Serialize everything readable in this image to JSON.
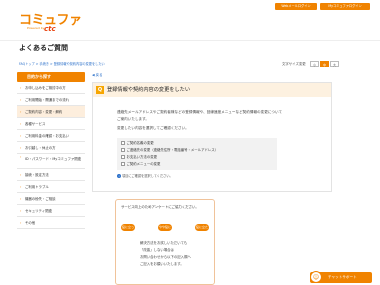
{
  "header": {
    "logo": "コミュファ",
    "logo_sub": "Powered by",
    "logo_brand": "ctc",
    "top_links": [
      "Webメールログイン",
      "Myコミュファログイン"
    ]
  },
  "page_title": "よくあるご質問",
  "breadcrumb": "FAQトップ > 手続き > 登録情報や契約内容の変更をしたい",
  "font_size": {
    "label": "文字サイズ変更",
    "small": "小",
    "medium": "中",
    "large": "大"
  },
  "sidebar": {
    "head": "目的から探す",
    "items": [
      {
        "label": "お申し込みをご検討中の方"
      },
      {
        "label": "ご利用開始・開通までの流れ"
      },
      {
        "label": "ご契約内容・変更・解約"
      },
      {
        "label": "各種サービス"
      },
      {
        "label": "ご利用料金の確認・お支払い"
      },
      {
        "label": "お引越し・休止の方"
      },
      {
        "label": "ID・パスワード・Myコミュファ関連"
      },
      {
        "label": "接続・設定方法"
      },
      {
        "label": "ご利用トラブル"
      },
      {
        "label": "機器の紛失・ご相談"
      },
      {
        "label": "セキュリティ関連"
      },
      {
        "label": "その他"
      }
    ]
  },
  "main": {
    "back": "◀ 戻る",
    "q_badge": "Q",
    "q_title": "登録情報や契約内容の変更をしたい",
    "body": [
      "連絡先メールアドレスやご契約者様などの登録情報や、回線速度メニューなど契約情報の変更について",
      "ご案内いたします。",
      "変更したい内容を選択してご確認ください。"
    ],
    "choices": [
      "ご契約名義の変更",
      "ご連絡先の変更（連絡先住所・電話番号・メールアドレス）",
      "お支払い方法の変更",
      "ご契約メニューの変更"
    ],
    "note": "項目にご確認を選択してください。"
  },
  "survey": {
    "title": "サービス向上のためアンケートにご協力ください。",
    "ratings": [
      "役に立った",
      "やや役に立った",
      "役に立たなかった"
    ],
    "text": [
      "解決方法をお試しいただいても",
      "「改善」しない場合は",
      "お問い合わせから以下の記入欄へ",
      "ご記入をお願いいたします。"
    ]
  },
  "chat": {
    "label": "チャットサポート"
  }
}
